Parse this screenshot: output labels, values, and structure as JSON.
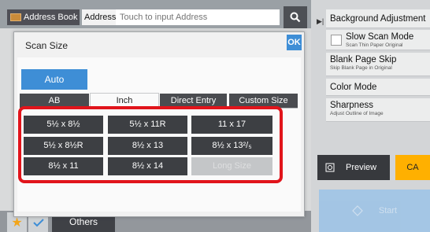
{
  "topbar": {
    "address_book_label": "Address Book",
    "address_label": "Address",
    "address_placeholder": "Touch to input Address"
  },
  "right_panel": {
    "background_adjustment": "Background Adjustment",
    "slow_scan": {
      "label": "Slow Scan Mode",
      "sub": "Scan Thin Paper Original"
    },
    "blank_page_skip": {
      "label": "Blank Page Skip",
      "sub": "Skip Blank Page in Original"
    },
    "color_mode": "Color Mode",
    "sharpness": {
      "label": "Sharpness",
      "sub": "Adjust Outline of Image"
    },
    "preview_label": "Preview",
    "ca_label": "CA",
    "start_label": "Start"
  },
  "bottom_bar": {
    "others_label": "Others"
  },
  "dialog": {
    "title": "Scan Size",
    "ok_label": "OK",
    "auto_label": "Auto",
    "tabs": [
      "AB",
      "Inch",
      "Direct Entry",
      "Custom Size"
    ],
    "active_tab": "Inch",
    "sizes": [
      [
        "5½ x 8½",
        "5½ x 11R",
        "11 x 17"
      ],
      [
        "5½ x 8½R",
        "8½ x 13",
        "8½ x 13²/₅"
      ],
      [
        "8½ x 11",
        "8½ x 14",
        "Long Size"
      ]
    ]
  },
  "colors": {
    "accent_blue": "#3e8ed6",
    "highlight_red": "#e1141b",
    "ca_orange": "#ffb000"
  }
}
